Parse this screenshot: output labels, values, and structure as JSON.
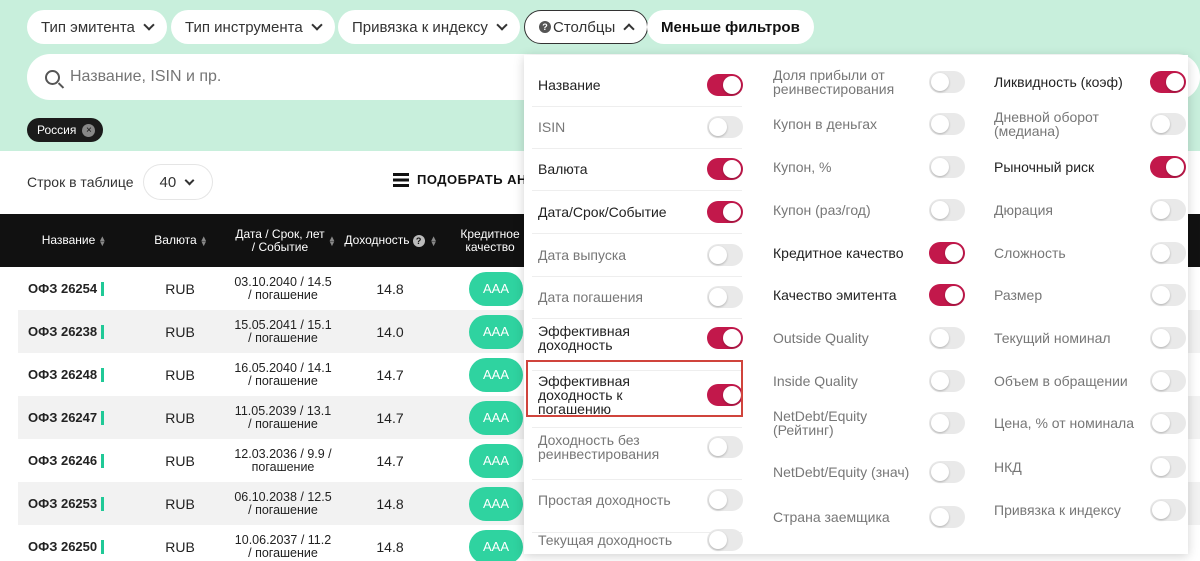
{
  "filters": {
    "issuer_type": "Тип эмитента",
    "instrument_type": "Тип инструмента",
    "index_binding": "Привязка к индексу",
    "columns": "Столбцы",
    "less_filters": "Меньше фильтров"
  },
  "search": {
    "placeholder": "Название, ISIN и пр."
  },
  "chip": {
    "label": "Россия"
  },
  "rows_bar": {
    "label": "Строк в таблице",
    "value": "40"
  },
  "pick_button": "ПОДОБРАТЬ АН",
  "table": {
    "headers": {
      "name": "Название",
      "currency": "Валюта",
      "date": "Дата / Срок, лет / Событие",
      "yield": "Доходность",
      "credit": "Кредитное качество"
    },
    "rows": [
      {
        "name": "ОФЗ 26254",
        "currency": "RUB",
        "date": "03.10.2040 / 14.5 / погашение",
        "yield": "14.8",
        "credit": "AAA"
      },
      {
        "name": "ОФЗ 26238",
        "currency": "RUB",
        "date": "15.05.2041 / 15.1 / погашение",
        "yield": "14.0",
        "credit": "AAA"
      },
      {
        "name": "ОФЗ 26248",
        "currency": "RUB",
        "date": "16.05.2040 / 14.1 / погашение",
        "yield": "14.7",
        "credit": "AAA"
      },
      {
        "name": "ОФЗ 26247",
        "currency": "RUB",
        "date": "11.05.2039 / 13.1 / погашение",
        "yield": "14.7",
        "credit": "AAA"
      },
      {
        "name": "ОФЗ 26246",
        "currency": "RUB",
        "date": "12.03.2036 / 9.9 / погашение",
        "yield": "14.7",
        "credit": "AAA"
      },
      {
        "name": "ОФЗ 26253",
        "currency": "RUB",
        "date": "06.10.2038 / 12.5 / погашение",
        "yield": "14.8",
        "credit": "AAA"
      },
      {
        "name": "ОФЗ 26250",
        "currency": "RUB",
        "date": "10.06.2037 / 11.2 / погашение",
        "yield": "14.8",
        "credit": "AAA"
      }
    ]
  },
  "columns_panel": {
    "col1": [
      {
        "label": "Название",
        "on": true
      },
      {
        "label": "ISIN",
        "on": false
      },
      {
        "label": "Валюта",
        "on": true
      },
      {
        "label": "Дата/Срок/Событие",
        "on": true
      },
      {
        "label": "Дата выпуска",
        "on": false
      },
      {
        "label": "Дата погашения",
        "on": false
      },
      {
        "label": "Эффективная доходность",
        "on": true
      },
      {
        "label": "Эффективная доходность к погашению",
        "on": true
      },
      {
        "label": "Доходность без реинвестирования",
        "on": false
      },
      {
        "label": "Простая доходность",
        "on": false
      },
      {
        "label": "Текущая доходность",
        "on": false
      }
    ],
    "col2": [
      {
        "label": "Доля прибыли от реинвестирования",
        "on": false
      },
      {
        "label": "Купон в деньгах",
        "on": false
      },
      {
        "label": "Купон, %",
        "on": false
      },
      {
        "label": "Купон (раз/год)",
        "on": false
      },
      {
        "label": "Кредитное качество",
        "on": true
      },
      {
        "label": "Качество эмитента",
        "on": true
      },
      {
        "label": "Outside Quality",
        "on": false
      },
      {
        "label": "Inside Quality",
        "on": false
      },
      {
        "label": "NetDebt/Equity (Рейтинг)",
        "on": false
      },
      {
        "label": "NetDebt/Equity (знач)",
        "on": false
      },
      {
        "label": "Страна заемщика",
        "on": false
      }
    ],
    "col3": [
      {
        "label": "Ликвидность (коэф)",
        "on": true
      },
      {
        "label": "Дневной оборот (медиана)",
        "on": false
      },
      {
        "label": "Рыночный риск",
        "on": true
      },
      {
        "label": "Дюрация",
        "on": false
      },
      {
        "label": "Сложность",
        "on": false
      },
      {
        "label": "Размер",
        "on": false
      },
      {
        "label": "Текущий номинал",
        "on": false
      },
      {
        "label": "Объем в обращении",
        "on": false
      },
      {
        "label": "Цена, % от номинала",
        "on": false
      },
      {
        "label": "НКД",
        "on": false
      },
      {
        "label": "Привязка к индексу",
        "on": false
      }
    ]
  },
  "colors": {
    "accent": "#c2184b",
    "top_bg": "#c8efdc",
    "badge": "#2fd3a0",
    "highlight": "#d0443c"
  }
}
